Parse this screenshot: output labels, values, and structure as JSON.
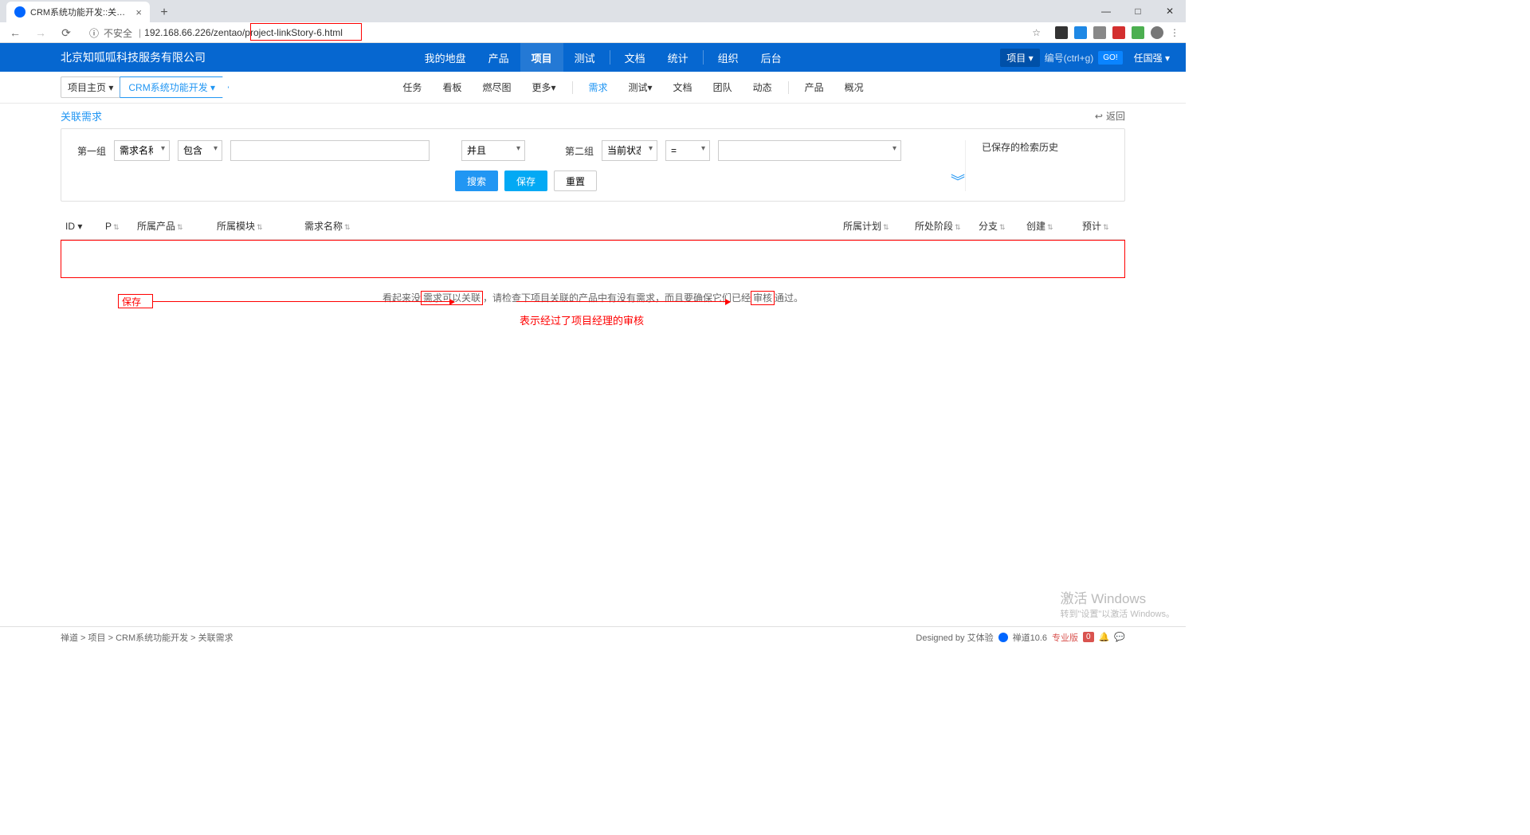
{
  "browser": {
    "tab_title": "CRM系统功能开发::关联需求 - 禅",
    "url_prefix": "192.168.66.226/zentao",
    "url_path": "/project-linkStory-6.html",
    "insecure_label": "不安全"
  },
  "header": {
    "company": "北京知呱呱科技服务有限公司",
    "nav": [
      "我的地盘",
      "产品",
      "项目",
      "测试",
      "文档",
      "统计",
      "组织",
      "后台"
    ],
    "active_nav": "项目",
    "proj_btn": "项目 ▾",
    "id_hint": "编号(ctrl+g)",
    "go": "GO!",
    "user": "任国强 ▾"
  },
  "subnav": {
    "crumb_label": "项目主页 ▾",
    "crumb_tag": "CRM系统功能开发 ▾",
    "items": [
      "任务",
      "看板",
      "燃尽图",
      "更多▾",
      "",
      "需求",
      "测试▾",
      "文档",
      "团队",
      "动态",
      "",
      "产品",
      "概况"
    ],
    "active": "需求"
  },
  "page": {
    "title": "关联需求",
    "back": "返回"
  },
  "search": {
    "group1": "第一组",
    "field1": "需求名称",
    "op1": "包含",
    "logic": "并且",
    "group2": "第二组",
    "field2": "当前状态",
    "op2": "=",
    "btn_search": "搜索",
    "btn_save": "保存",
    "btn_reset": "重置",
    "history_title": "已保存的检索历史"
  },
  "table": {
    "cols": [
      "ID ▾",
      "P",
      "所属产品",
      "所属模块",
      "需求名称",
      "所属计划",
      "所处阶段",
      "分支",
      "创建",
      "预计"
    ]
  },
  "empty": {
    "prefix": "看起来没",
    "box1": "需求可以关联",
    "mid": "，请检查下项目关联的产品中有没有需求，而且要确保它们已经",
    "box2": "审核",
    "suffix": "通过。"
  },
  "anno": {
    "save_box": "保存",
    "red_text": "表示经过了项目经理的审核"
  },
  "footer": {
    "crumbs": "禅道 > 项目 > CRM系统功能开发 > 关联需求",
    "designed": "Designed by 艾体验",
    "version": "禅道10.6",
    "edition": "专业版",
    "notif": "0"
  },
  "watermark": {
    "l1": "激活 Windows",
    "l2": "转到\"设置\"以激活 Windows。"
  }
}
